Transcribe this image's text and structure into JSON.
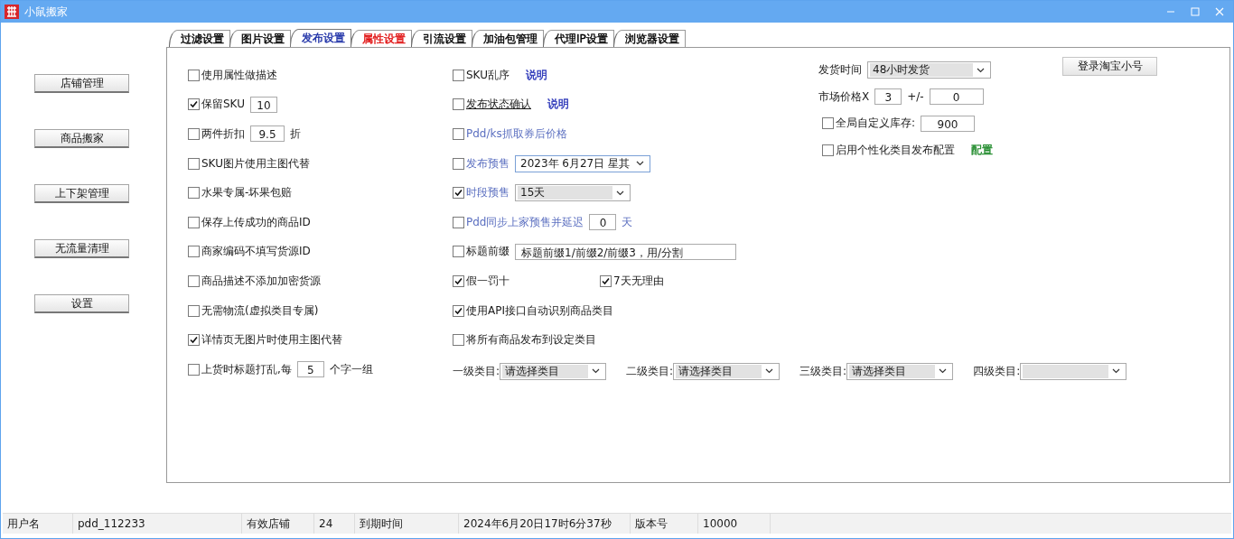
{
  "window": {
    "title": "小鼠搬家"
  },
  "sidebar": {
    "buttons": [
      "店铺管理",
      "商品搬家",
      "上下架管理",
      "无流量清理",
      "设置"
    ]
  },
  "tabs": [
    {
      "label": "过滤设置",
      "selected": false,
      "color": "#000000"
    },
    {
      "label": "图片设置",
      "selected": false,
      "color": "#000000"
    },
    {
      "label": "发布设置",
      "selected": true,
      "color": "#1c2fa6"
    },
    {
      "label": "属性设置",
      "selected": false,
      "color": "#e01010"
    },
    {
      "label": "引流设置",
      "selected": false,
      "color": "#000000"
    },
    {
      "label": "加油包管理",
      "selected": false,
      "color": "#000000"
    },
    {
      "label": "代理IP设置",
      "selected": false,
      "color": "#000000"
    },
    {
      "label": "浏览器设置",
      "selected": false,
      "color": "#000000"
    }
  ],
  "column_1": [
    {
      "parts": [
        {
          "kind": "check",
          "label": "使用属性做描述",
          "checked": false
        }
      ]
    },
    {
      "parts": [
        {
          "kind": "check",
          "label": "保留SKU",
          "checked": true
        },
        {
          "kind": "input",
          "value": "10"
        }
      ]
    },
    {
      "parts": [
        {
          "kind": "check",
          "label": "两件折扣",
          "checked": false
        },
        {
          "kind": "input",
          "value": "9.5"
        },
        {
          "kind": "text",
          "text": "折"
        }
      ]
    },
    {
      "parts": [
        {
          "kind": "check",
          "label": "SKU图片使用主图代替",
          "checked": false
        }
      ]
    },
    {
      "parts": [
        {
          "kind": "check",
          "label": "水果专属-坏果包赔",
          "checked": false
        }
      ]
    },
    {
      "parts": [
        {
          "kind": "check",
          "label": "保存上传成功的商品ID",
          "checked": false
        }
      ]
    },
    {
      "parts": [
        {
          "kind": "check",
          "label": "商家编码不填写货源ID",
          "checked": false
        }
      ]
    },
    {
      "parts": [
        {
          "kind": "check",
          "label": "商品描述不添加加密货源",
          "checked": false
        }
      ]
    },
    {
      "parts": [
        {
          "kind": "check",
          "label": "无需物流(虚拟类目专属)",
          "checked": false
        }
      ]
    },
    {
      "parts": [
        {
          "kind": "check",
          "label": "详情页无图片时使用主图代替",
          "checked": true
        }
      ]
    },
    {
      "parts": [
        {
          "kind": "check",
          "label": "上货时标题打乱,每",
          "checked": false
        },
        {
          "kind": "input",
          "value": "5"
        },
        {
          "kind": "text",
          "text": "个字一组"
        }
      ]
    }
  ],
  "column_2": [
    {
      "parts": [
        {
          "kind": "check",
          "label": "SKU乱序",
          "checked": false
        },
        {
          "kind": "link",
          "text": "说明",
          "color": "#2a35b8"
        }
      ]
    },
    {
      "parts": [
        {
          "kind": "check",
          "label": "发布状态确认",
          "checked": false,
          "underline": true
        },
        {
          "kind": "link",
          "text": "说明",
          "color": "#2a35b8"
        }
      ]
    },
    {
      "parts": [
        {
          "kind": "check",
          "label": "Pdd/ks抓取券后价格",
          "checked": false,
          "color": "#5b6fc0"
        }
      ]
    },
    {
      "parts": [
        {
          "kind": "check",
          "label": "发布预售",
          "checked": false,
          "color": "#5b6fc0"
        },
        {
          "kind": "select",
          "value": "2023年 6月27日 星其"
        }
      ]
    },
    {
      "parts": [
        {
          "kind": "check",
          "label": "时段预售",
          "checked": true,
          "color": "#5b6fc0"
        },
        {
          "kind": "select",
          "value": "15天"
        }
      ]
    },
    {
      "parts": [
        {
          "kind": "check",
          "label": "Pdd同步上家预售并延迟",
          "checked": false,
          "color": "#5b6fc0"
        },
        {
          "kind": "input",
          "value": "0"
        },
        {
          "kind": "text",
          "text": "天",
          "color": "#5b6fc0"
        }
      ]
    },
    {
      "parts": [
        {
          "kind": "check",
          "label": "标题前缀",
          "checked": false
        },
        {
          "kind": "input",
          "value": "标题前缀1/前缀2/前缀3，用/分割"
        }
      ]
    },
    {
      "parts": [
        {
          "kind": "check",
          "label": "假一罚十",
          "checked": true
        },
        {
          "kind": "check",
          "label": "7天无理由",
          "checked": true
        }
      ]
    },
    {
      "parts": [
        {
          "kind": "check",
          "label": "使用API接口自动识别商品类目",
          "checked": true
        }
      ]
    },
    {
      "parts": [
        {
          "kind": "check",
          "label": "将所有商品发布到设定类目",
          "checked": false
        }
      ]
    }
  ],
  "column_3": [
    {
      "parts": [
        {
          "kind": "text",
          "text": "发货时间"
        },
        {
          "kind": "select",
          "value": "48小时发货"
        }
      ]
    },
    {
      "parts": [
        {
          "kind": "text",
          "text": "市场价格X"
        },
        {
          "kind": "input",
          "value": "3"
        },
        {
          "kind": "text",
          "text": "+/-"
        },
        {
          "kind": "input",
          "value": "0"
        }
      ]
    },
    {
      "parts": [
        {
          "kind": "check",
          "label": "全局自定义库存:",
          "checked": false
        },
        {
          "kind": "input",
          "value": "900"
        }
      ]
    },
    {
      "parts": [
        {
          "kind": "check",
          "label": "启用个性化类目发布配置",
          "checked": false
        },
        {
          "kind": "link",
          "text": "配置",
          "color": "#1f8a2a"
        }
      ]
    }
  ],
  "login_button": "登录淘宝小号",
  "categories": [
    {
      "label": "一级类目:",
      "value": "请选择类目"
    },
    {
      "label": "二级类目:",
      "value": "请选择类目"
    },
    {
      "label": "三级类目:",
      "value": "请选择类目"
    },
    {
      "label": "四级类目:"
    }
  ],
  "status_bar": [
    "用户名",
    "pdd_112233",
    "有效店铺",
    "24",
    "到期时间",
    "2024年6月20日17时6分37秒",
    "版本号",
    "10000"
  ]
}
